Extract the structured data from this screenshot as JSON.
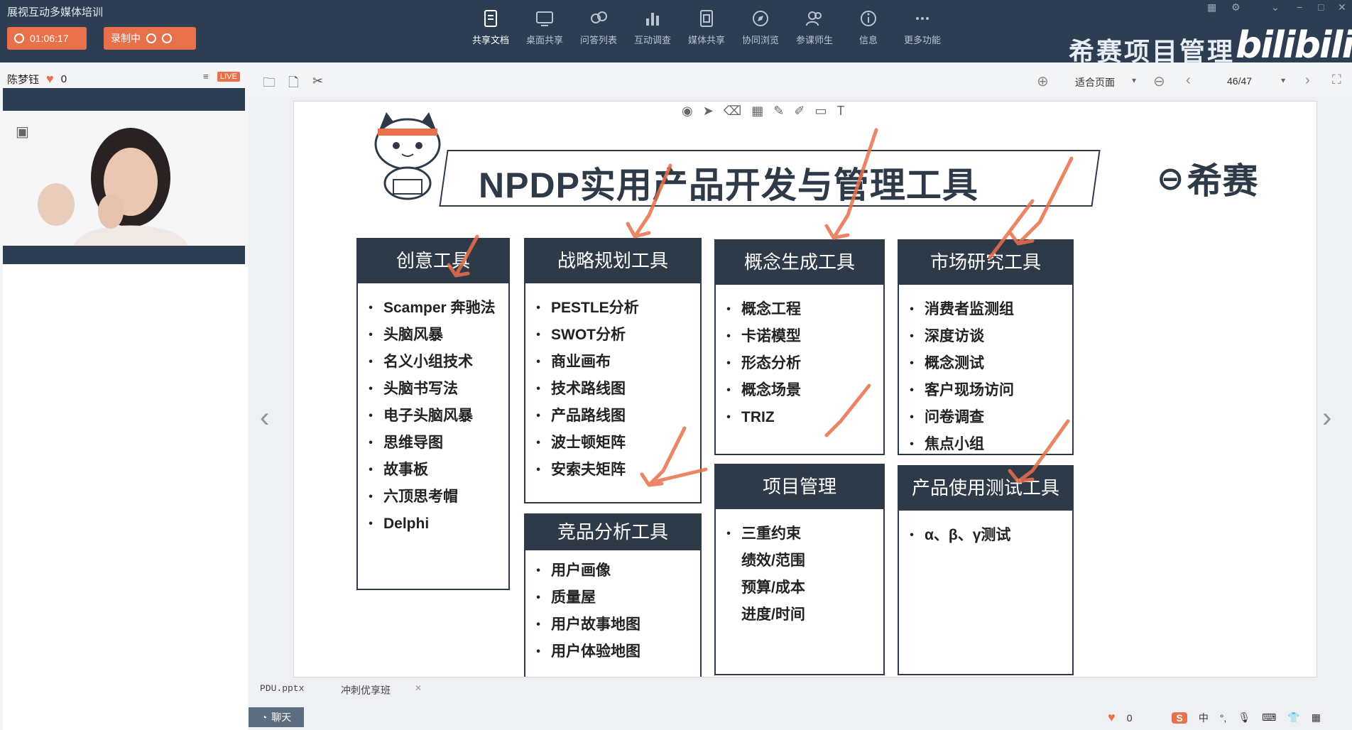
{
  "app": {
    "title": "展视互动多媒体培训"
  },
  "timer": "01:06:17",
  "recording_label": "录制中",
  "toolbar": [
    {
      "label": "共享文档",
      "icon": "document-icon",
      "active": true
    },
    {
      "label": "桌面共享",
      "icon": "desktop-share-icon"
    },
    {
      "label": "问答列表",
      "icon": "qa-list-icon"
    },
    {
      "label": "互动调查",
      "icon": "survey-icon"
    },
    {
      "label": "媒体共享",
      "icon": "media-share-icon"
    },
    {
      "label": "协同浏览",
      "icon": "co-browse-icon"
    },
    {
      "label": "参课师生",
      "icon": "participants-icon"
    },
    {
      "label": "信息",
      "icon": "info-icon"
    },
    {
      "label": "更多功能",
      "icon": "more-icon"
    }
  ],
  "brand": {
    "text": "希赛项目管理",
    "bilibili": "bilibili"
  },
  "user": {
    "name": "陈梦钰",
    "likes": "0",
    "live": "LIVE"
  },
  "doc": {
    "fit": "适合页面",
    "page": "46/47"
  },
  "slide": {
    "title": "NPDP实用产品开发与管理工具",
    "logo_text": "希赛",
    "cards": [
      {
        "id": "creative",
        "header": "创意工具",
        "items": [
          "Scamper 奔驰法",
          "头脑风暴",
          "名义小组技术",
          "头脑书写法",
          "电子头脑风暴",
          "思维导图",
          "故事板",
          "六顶思考帽",
          "Delphi"
        ]
      },
      {
        "id": "strategy",
        "header": "战略规划工具",
        "items": [
          "PESTLE分析",
          "SWOT分析",
          "商业画布",
          "技术路线图",
          "产品路线图",
          "波士顿矩阵",
          "安索夫矩阵"
        ]
      },
      {
        "id": "competitor",
        "header": "竞品分析工具",
        "items": [
          "用户画像",
          "质量屋",
          "用户故事地图",
          "用户体验地图"
        ]
      },
      {
        "id": "concept",
        "header": "概念生成工具",
        "items": [
          "概念工程",
          "卡诺模型",
          "形态分析",
          "概念场景",
          "TRIZ"
        ]
      },
      {
        "id": "project",
        "header": "项目管理",
        "items": [
          "三重约束",
          "绩效/范围",
          "预算/成本",
          "进度/时间"
        ]
      },
      {
        "id": "market",
        "header": "市场研究工具",
        "items": [
          "消费者监测组",
          "深度访谈",
          "概念测试",
          "客户现场访问",
          "问卷调查",
          "焦点小组"
        ]
      },
      {
        "id": "usage",
        "header": "产品使用测试工具",
        "items": [
          "α、β、γ测试"
        ]
      }
    ]
  },
  "bottom": {
    "file": "PDU.pptx",
    "file2": "冲刺优享班",
    "chat": "聊天",
    "likes": "0",
    "ime": "中"
  },
  "colors": {
    "topbar": "#2d3e52",
    "accent": "#e8704a",
    "card": "#2e3a48"
  }
}
